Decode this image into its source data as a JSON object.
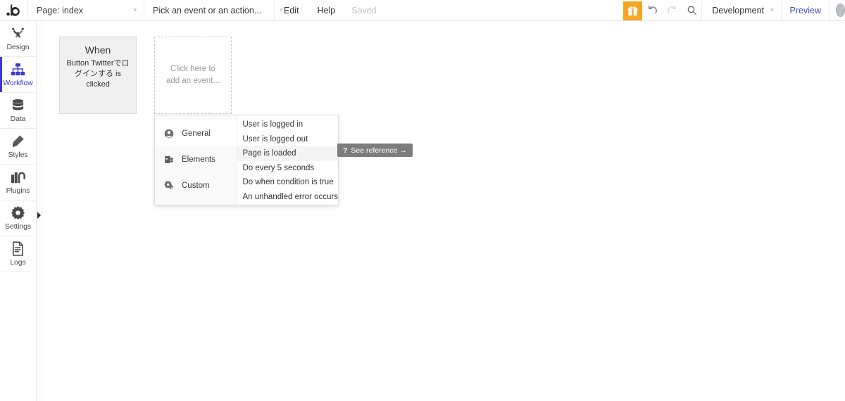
{
  "topbar": {
    "logo_icon": "bubble-logo-icon",
    "page_selector": {
      "label": "Page: index",
      "caret": "▾"
    },
    "event_selector": {
      "label": "Pick an event or an action...",
      "caret": "▾"
    },
    "edit_label": "Edit",
    "help_label": "Help",
    "saved_label": "Saved",
    "gift_icon": "gift-icon",
    "undo_icon": "undo-icon",
    "redo_icon": "redo-icon",
    "search_icon": "search-icon",
    "version_label": "Development",
    "version_caret": "▾",
    "preview_label": "Preview",
    "avatar_icon": "avatar-icon",
    "accent_color": "#f5a623",
    "link_color": "#3b4cc0"
  },
  "sidebar": {
    "active_color": "#3b3bd0",
    "collapse_icon": "collapse-arrow-icon",
    "items": [
      {
        "label": "Design",
        "icon": "design-icon",
        "active": false
      },
      {
        "label": "Workflow",
        "icon": "workflow-icon",
        "active": true
      },
      {
        "label": "Data",
        "icon": "data-icon",
        "active": false
      },
      {
        "label": "Styles",
        "icon": "styles-icon",
        "active": false
      },
      {
        "label": "Plugins",
        "icon": "plugins-icon",
        "active": false
      },
      {
        "label": "Settings",
        "icon": "settings-icon",
        "active": false
      },
      {
        "label": "Logs",
        "icon": "logs-icon",
        "active": false
      }
    ]
  },
  "canvas": {
    "when_card": {
      "title": "When",
      "description": "Button Twitterでログインする is clicked"
    },
    "add_event_placeholder": "Click here to add an event..."
  },
  "event_menu": {
    "categories": [
      {
        "label": "General",
        "icon": "user-circle-icon",
        "active": true
      },
      {
        "label": "Elements",
        "icon": "element-icon",
        "active": false
      },
      {
        "label": "Custom",
        "icon": "gears-icon",
        "active": false
      }
    ],
    "options": [
      {
        "label": "User is logged in",
        "hovered": false
      },
      {
        "label": "User is logged out",
        "hovered": false
      },
      {
        "label": "Page is loaded",
        "hovered": true
      },
      {
        "label": "Do every 5 seconds",
        "hovered": false
      },
      {
        "label": "Do when condition is true",
        "hovered": false
      },
      {
        "label": "An unhandled error occurs",
        "hovered": false
      }
    ]
  },
  "tooltip": {
    "marker": "?",
    "label": "See reference →",
    "background": "#7d7d7d"
  }
}
